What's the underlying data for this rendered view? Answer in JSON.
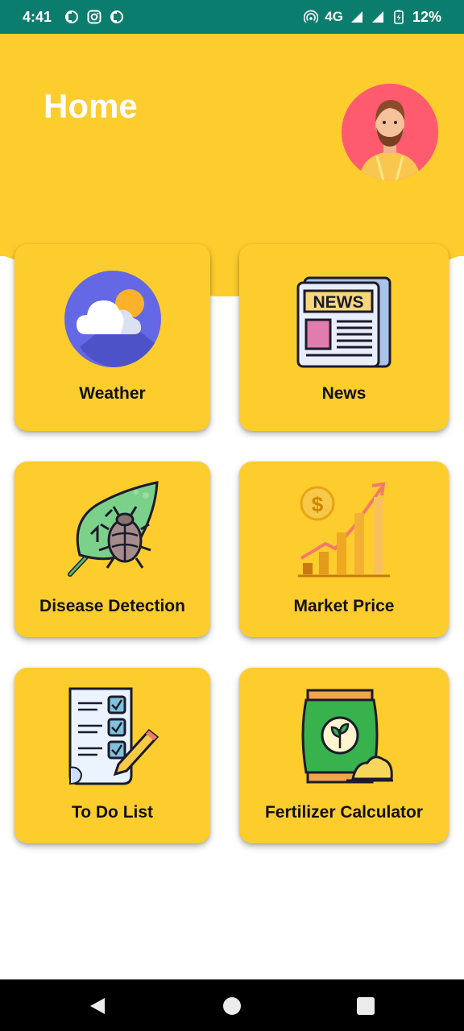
{
  "status_bar": {
    "time": "4:41",
    "network": "4G",
    "battery": "12%",
    "icons": [
      "app-notification-icon",
      "instagram-icon",
      "app-notification-icon",
      "hotspot-icon",
      "signal-icon",
      "battery-charging-icon"
    ]
  },
  "header": {
    "title": "Home",
    "avatar_icon": "user-avatar",
    "accent_color": "#fdcd2e"
  },
  "tiles": [
    {
      "label": "Weather",
      "icon": "weather-icon"
    },
    {
      "label": "News",
      "icon": "newspaper-icon"
    },
    {
      "label": "Disease Detection",
      "icon": "leaf-beetle-icon"
    },
    {
      "label": "Market Price",
      "icon": "price-growth-chart-icon"
    },
    {
      "label": "To Do List",
      "icon": "checklist-icon"
    },
    {
      "label": "Fertilizer Calculator",
      "icon": "fertilizer-bag-icon"
    }
  ],
  "nav_bar": {
    "buttons": [
      "back-icon",
      "home-icon",
      "recents-icon"
    ]
  }
}
